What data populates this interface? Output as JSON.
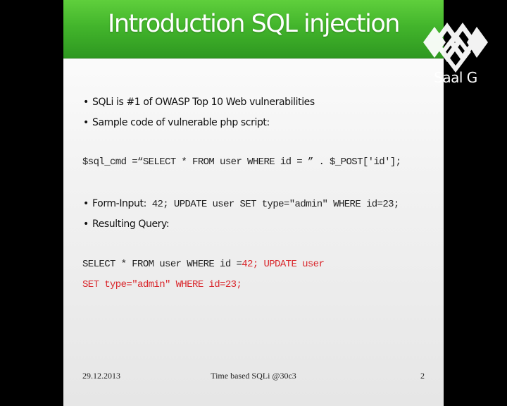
{
  "slide": {
    "title": "Introduction SQL injection",
    "bullets_top": [
      "SQLi is #1 of OWASP Top 10 Web vulnerabilities",
      "Sample code of vulnerable php script:"
    ],
    "code_sample": "$sql_cmd =“SELECT * FROM user WHERE id = ” . $_POST['id'];",
    "form_input": {
      "label": "Form-Input:",
      "value": " 42; UPDATE user SET type=\"admin\" WHERE id=23;"
    },
    "resulting_query_label": "Resulting Query:",
    "result_line1": {
      "plain": "SELECT * FROM user WHERE id =",
      "injected": "42; UPDATE user"
    },
    "result_line2": "SET type=\"admin\" WHERE id=23;",
    "injected_color": "#d9262b",
    "header_color": "#43b52c"
  },
  "footer": {
    "date": "29.12.2013",
    "center": "Time based SQLi @30c3",
    "page": "2"
  },
  "logo": {
    "text": "Saal G",
    "icon": "saal-g-logo-icon"
  }
}
